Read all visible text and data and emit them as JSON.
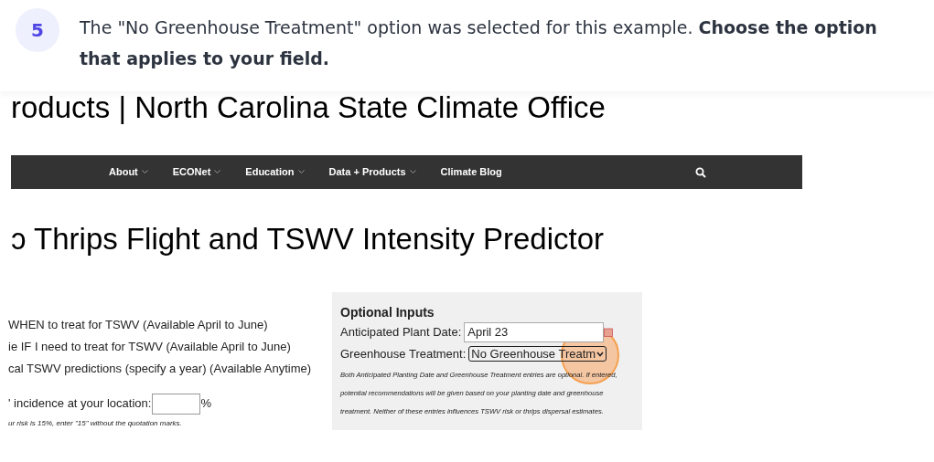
{
  "step": {
    "number": "5",
    "text": "The \"No Greenhouse Treatment\" option was selected for this example. **Choose the option that applies to your field.**"
  },
  "site": {
    "title": "roducts | North Carolina State Climate Office",
    "nav": [
      {
        "label": "About",
        "dropdown": true
      },
      {
        "label": "ECONet",
        "dropdown": true
      },
      {
        "label": "Education",
        "dropdown": true
      },
      {
        "label": "Data + Products",
        "dropdown": true
      },
      {
        "label": "Climate Blog",
        "dropdown": false
      }
    ],
    "heading": "Thrips Flight and TSWV Intensity Predictor",
    "heading_prefix": "ɔ",
    "options": [
      "WHEN to treat for TSWV (Available April to June)",
      "ie IF I need to treat for TSWV (Available April to June)",
      "cal TSWV predictions (specify a year) (Available Anytime)"
    ],
    "incidence": {
      "label": "' incidence at your location:",
      "unit": "%"
    },
    "incidence_hint": "ur risk is 15%, enter \"15\" without the quotation marks.",
    "optional": {
      "title": "Optional Inputs",
      "plant_date": {
        "label": "Anticipated Plant Date:",
        "value": "April 23"
      },
      "greenhouse": {
        "label": "Greenhouse Treatment:",
        "value": "No Greenhouse Treatm"
      },
      "note": "Both Anticipated Planting Date and Greenhouse Treatment entries are optional. If entered, potential recommendations will be given based on your planting date and greenhouse treatment. Neither of these entries influences TSWV risk or thrips dispersal estimates."
    }
  }
}
